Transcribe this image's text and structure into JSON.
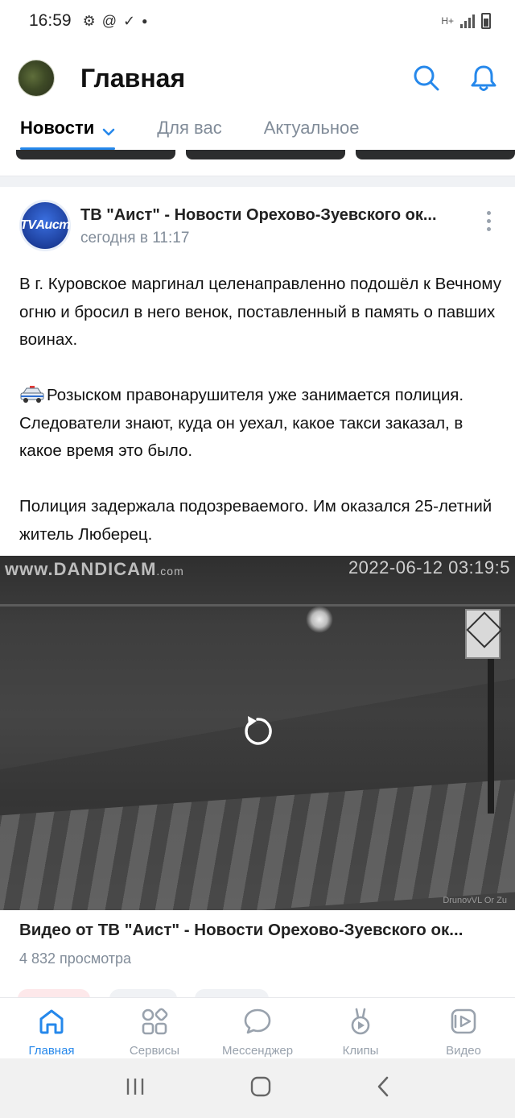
{
  "status_bar": {
    "time": "16:59",
    "network": "H+"
  },
  "header": {
    "title": "Главная",
    "icons": [
      "avatar",
      "search-icon",
      "bell-icon"
    ]
  },
  "tabs": [
    {
      "label": "Новости",
      "active": true
    },
    {
      "label": "Для вас",
      "active": false
    },
    {
      "label": "Актуальное",
      "active": false
    }
  ],
  "post": {
    "author": "ТВ \"Аист\" - Новости Орехово-Зуевского ок...",
    "time": "сегодня в 11:17",
    "logo_text": "TVАист",
    "paragraphs": [
      "В г. Куровское маргинал целенаправленно подошёл к Вечному огню и бросил в него венок, поставленный в память о павших воинах.",
      "Розыском правонарушителя уже занимается полиция. Следователи знают, куда он уехал, какое такси заказал, в какое время это было.",
      "Полиция задержала подозреваемого. Им оказался 25-летний житель Люберец."
    ],
    "video": {
      "watermark": "www.DANDICAM",
      "watermark_suffix": ".com",
      "timestamp": "2022-06-12 03:19:5",
      "corner_text": "DrunovVL Or Zu",
      "title": "Видео от ТВ \"Аист\" - Новости Орехово-Зуевского ок...",
      "views": "4 832 просмотра"
    }
  },
  "bottom_nav": [
    {
      "label": "Главная",
      "icon": "home-icon",
      "active": true
    },
    {
      "label": "Сервисы",
      "icon": "services-icon",
      "active": false
    },
    {
      "label": "Мессенджер",
      "icon": "messenger-icon",
      "active": false
    },
    {
      "label": "Клипы",
      "icon": "clips-icon",
      "active": false
    },
    {
      "label": "Видео",
      "icon": "video-icon",
      "active": false
    }
  ],
  "colors": {
    "accent": "#2688eb",
    "secondary_text": "#818c99",
    "inactive_icon": "#99a2ad"
  }
}
